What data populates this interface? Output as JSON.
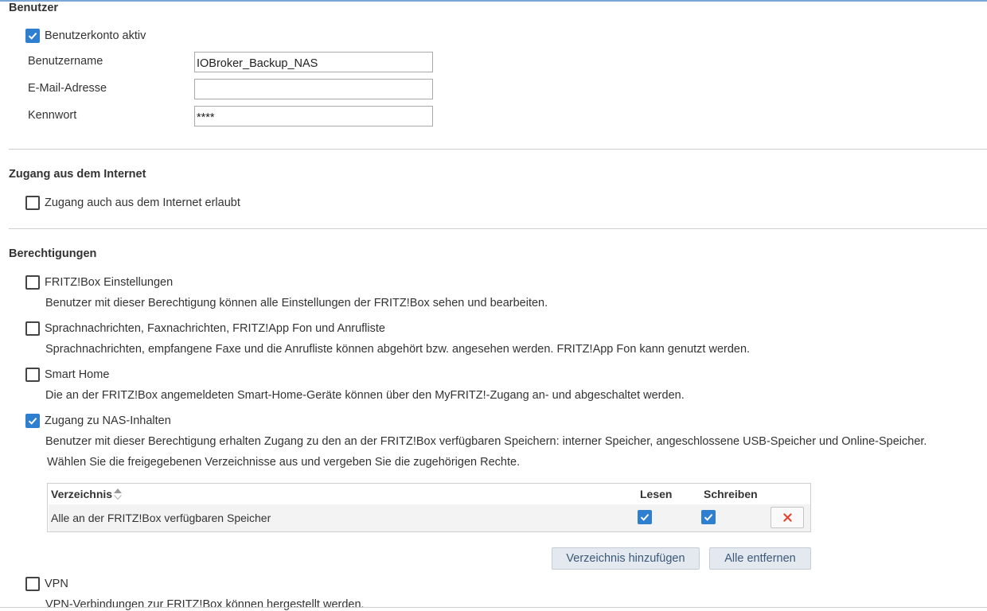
{
  "user_section": {
    "title": "Benutzer",
    "account_active": {
      "label": "Benutzerkonto aktiv",
      "checked": true
    },
    "username": {
      "label": "Benutzername",
      "value": "IOBroker_Backup_NAS"
    },
    "email": {
      "label": "E-Mail-Adresse",
      "value": ""
    },
    "password": {
      "label": "Kennwort",
      "value": "****"
    }
  },
  "internet_section": {
    "title": "Zugang aus dem Internet",
    "internet_access": {
      "label": "Zugang auch aus dem Internet erlaubt",
      "checked": false
    }
  },
  "permissions_section": {
    "title": "Berechtigungen",
    "items": [
      {
        "label": "FRITZ!Box Einstellungen",
        "checked": false,
        "description": "Benutzer mit dieser Berechtigung können alle Einstellungen der FRITZ!Box sehen und bearbeiten."
      },
      {
        "label": "Sprachnachrichten, Faxnachrichten, FRITZ!App Fon und Anrufliste",
        "checked": false,
        "description": "Sprachnachrichten, empfangene Faxe und die Anrufliste können abgehört bzw. angesehen werden. FRITZ!App Fon kann genutzt werden."
      },
      {
        "label": "Smart Home",
        "checked": false,
        "description": "Die an der FRITZ!Box angemeldeten Smart-Home-Geräte können über den MyFRITZ!-Zugang an- und abgeschaltet werden."
      },
      {
        "label": "Zugang zu NAS-Inhalten",
        "checked": true,
        "description": "Benutzer mit dieser Berechtigung erhalten Zugang zu den an der FRITZ!Box verfügbaren Speichern: interner Speicher, angeschlossene USB-Speicher und Online-Speicher.",
        "description2": "Wählen Sie die freigegebenen Verzeichnisse aus und vergeben Sie die zugehörigen Rechte."
      },
      {
        "label": "VPN",
        "checked": false,
        "description": "VPN-Verbindungen zur FRITZ!Box können hergestellt werden."
      }
    ],
    "nas_table": {
      "columns": {
        "directory": "Verzeichnis",
        "read": "Lesen",
        "write": "Schreiben"
      },
      "rows": [
        {
          "directory": "Alle an der FRITZ!Box verfügbaren Speicher",
          "read": true,
          "write": true
        }
      ]
    },
    "buttons": {
      "add_directory": "Verzeichnis hinzufügen",
      "remove_all": "Alle entfernen"
    }
  },
  "icons": {
    "checkmark": "checkmark-icon",
    "delete": "close-icon",
    "sort": "sort-icon"
  },
  "colors": {
    "accent": "#2f7fd0",
    "delete_red": "#e8412f",
    "button_bg": "#e4e9ef",
    "button_text": "#3b5878"
  }
}
